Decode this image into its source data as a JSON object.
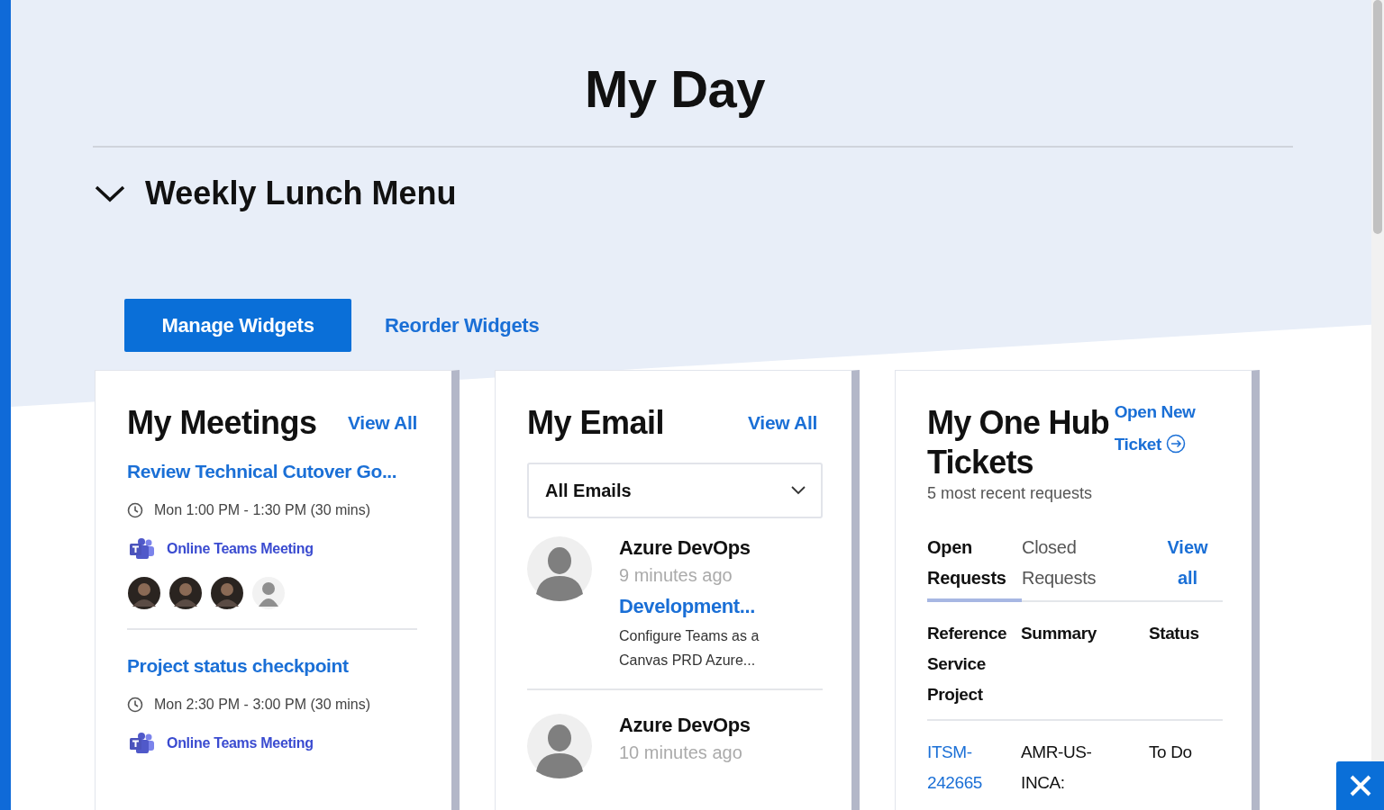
{
  "page": {
    "title": "My Day"
  },
  "section": {
    "title": "Weekly Lunch Menu",
    "expanded": true
  },
  "actions": [
    {
      "label": "Manage Widgets",
      "kind": "button"
    },
    {
      "label": "Reorder Widgets",
      "kind": "link"
    }
  ],
  "meetings": {
    "title": "My Meetings",
    "view_all": "View All",
    "items": [
      {
        "title": "Review Technical Cutover Go...",
        "time": "Mon 1:00 PM - 1:30 PM (30 mins)",
        "location": "Online Teams Meeting",
        "attendees": [
          {
            "kind": "photo"
          },
          {
            "kind": "photo"
          },
          {
            "kind": "photo"
          },
          {
            "kind": "placeholder"
          }
        ]
      },
      {
        "title": "Project status checkpoint",
        "time": "Mon 2:30 PM - 3:00 PM (30 mins)",
        "location": "Online Teams Meeting"
      }
    ]
  },
  "email": {
    "title": "My Email",
    "view_all": "View All",
    "filter": "All Emails",
    "items": [
      {
        "sender": "Azure DevOps",
        "time": "9 minutes ago",
        "subject": "Development...",
        "preview": "Configure Teams as a Canvas PRD Azure..."
      },
      {
        "sender": "Azure DevOps",
        "time": "10 minutes ago"
      }
    ]
  },
  "tickets": {
    "title": "My One Hub Tickets",
    "action": "Open New Ticket",
    "subtitle": "5 most recent requests",
    "tabs": [
      {
        "label": "Open Requests",
        "selected": true
      },
      {
        "label": "Closed Requests",
        "selected": false
      }
    ],
    "view_all": "View all",
    "columns": [
      "Reference Service Project",
      "Summary",
      "Status"
    ],
    "rows": [
      [
        "ITSM-242665",
        "AMR-US-INCA:",
        "To Do"
      ]
    ]
  }
}
